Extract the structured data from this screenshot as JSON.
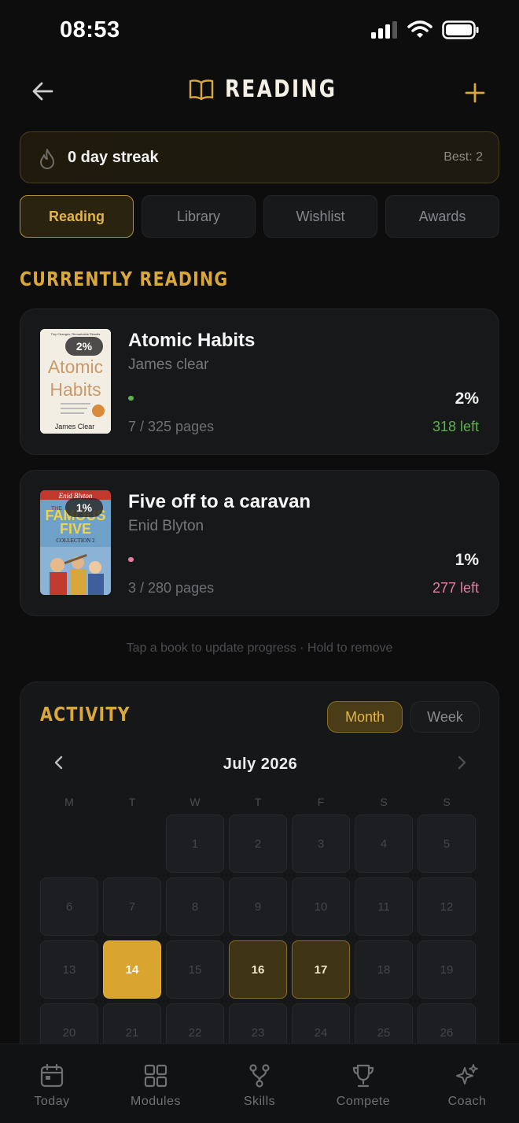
{
  "status_bar": {
    "time": "08:53"
  },
  "header": {
    "title": "READING"
  },
  "streak": {
    "text": "0 day streak",
    "best": "Best: 2"
  },
  "tabs": [
    {
      "label": "Reading",
      "active": true
    },
    {
      "label": "Library",
      "active": false
    },
    {
      "label": "Wishlist",
      "active": false
    },
    {
      "label": "Awards",
      "active": false
    }
  ],
  "currently_reading": {
    "heading": "CURRENTLY READING",
    "books": [
      {
        "title": "Atomic Habits",
        "author": "James clear",
        "badge": "2%",
        "percent_label": "2%",
        "progress": 0.02,
        "pages": "7 / 325 pages",
        "left": "318 left",
        "accent": "#5fb24a",
        "cover": {
          "title_line1": "Atomic",
          "title_line2": "Habits",
          "author": "James Clear",
          "top": "Tiny Changes, Remarkable Results"
        }
      },
      {
        "title": "Five off to a caravan",
        "author": "Enid Blyton",
        "badge": "1%",
        "percent_label": "1%",
        "progress": 0.01,
        "pages": "3 / 280 pages",
        "left": "277 left",
        "accent": "#e47fa0",
        "cover": {
          "brand": "Enid Blyton",
          "line1": "THE",
          "line2": "FAMOUS",
          "line3": "FIVE",
          "line4": "COLLECTION 2"
        }
      }
    ]
  },
  "hint": "Tap a book to update progress · Hold to remove",
  "activity": {
    "heading": "ACTIVITY",
    "toggle": {
      "month": "Month",
      "week": "Week",
      "selected": "Month"
    },
    "month_label": "July 2026",
    "weekdays": [
      "M",
      "T",
      "W",
      "T",
      "F",
      "S",
      "S"
    ],
    "leading_blanks": 2,
    "days": [
      "1",
      "2",
      "3",
      "4",
      "5",
      "6",
      "7",
      "8",
      "9",
      "10",
      "11",
      "12",
      "13",
      "14",
      "15",
      "16",
      "17",
      "18",
      "19",
      "20",
      "21",
      "22",
      "23",
      "24",
      "25",
      "26"
    ],
    "today": "14",
    "read_days": [
      "16",
      "17"
    ]
  },
  "bottom_nav": [
    {
      "label": "Today",
      "icon": "calendar-icon"
    },
    {
      "label": "Modules",
      "icon": "grid-icon"
    },
    {
      "label": "Skills",
      "icon": "skills-icon"
    },
    {
      "label": "Compete",
      "icon": "trophy-icon"
    },
    {
      "label": "Coach",
      "icon": "sparkles-icon"
    }
  ],
  "colors": {
    "accent": "#d9a73a",
    "background": "#0d0d0e",
    "card": "#17181a"
  }
}
